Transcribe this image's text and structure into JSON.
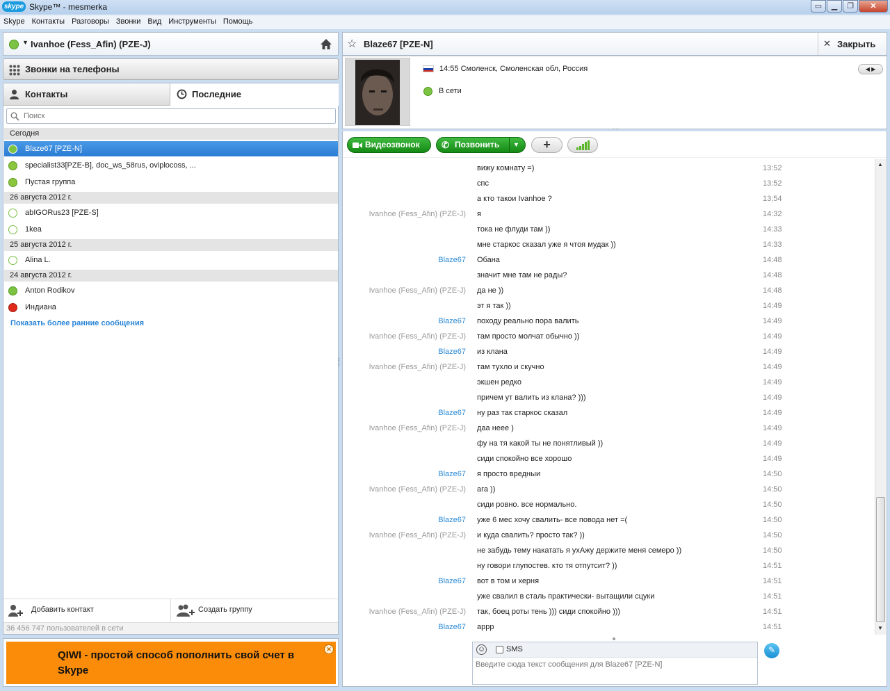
{
  "window": {
    "title": "Skype™ - mesmerka",
    "logo": "skype",
    "min": "▭",
    "restore": "▁",
    "max": "❐",
    "close": "✕"
  },
  "menu": [
    "Skype",
    "Контакты",
    "Разговоры",
    "Звонки",
    "Вид",
    "Инструменты",
    "Помощь"
  ],
  "profile": {
    "name": "Ivanhoe (Fess_Afin) (PZE-J)",
    "home_icon": "home-icon"
  },
  "phones": {
    "label": "Звонки на телефоны"
  },
  "tabs": {
    "contacts": "Контакты",
    "recent": "Последние"
  },
  "search": {
    "placeholder": "Поиск"
  },
  "recent": {
    "group_today": "Сегодня",
    "c1": "Blaze67 [PZE-N]",
    "c2": "specialist33[PZE-B], doc_ws_58rus, oviplocoss, ...",
    "c3": "Пустая группа",
    "group_aug26": "26 августа 2012 г.",
    "c4": "abIGORus23 [PZE-S]",
    "c5": "1kea",
    "group_aug25": "25 августа 2012 г.",
    "c6": "Alina L.",
    "group_aug24": "24 августа 2012 г.",
    "c7": "Anton Rodikov",
    "c8": "Индиана",
    "show_earlier": "Показать более ранние сообщения"
  },
  "bottom": {
    "add_contact": "Добавить контакт",
    "create_group": "Создать группу",
    "online_count": "36 456 747 пользователей в сети"
  },
  "ad": {
    "text": "QIWI - простой способ пополнить свой счет в Skype"
  },
  "chat": {
    "contact_name": "Blaze67 [PZE-N]",
    "close_label": "Закрыть",
    "location": "14:55 Смоленск, Смоленская обл, Россия",
    "status": "В сети",
    "video_btn": "Видеозвонок",
    "call_btn": "Позвонить",
    "plus_btn": "+",
    "input_placeholder": "Введите сюда текст сообщения для Blaze67 [PZE-N]",
    "sms_label": "SMS"
  },
  "messages": [
    {
      "author": "",
      "text": "вижу комнату =)",
      "time": "13:52",
      "who": ""
    },
    {
      "author": "",
      "text": "спс",
      "time": "13:52",
      "who": ""
    },
    {
      "author": "",
      "text": "а кто такои  Ivanhoe ?",
      "time": "13:54",
      "who": ""
    },
    {
      "author": "Ivanhoe (Fess_Afin) (PZE-J)",
      "text": "я",
      "time": "14:32",
      "who": "me"
    },
    {
      "author": "",
      "text": "тока не флуди там ))",
      "time": "14:33",
      "who": ""
    },
    {
      "author": "",
      "text": "мне старкос сказал уже я чтоя  мудак ))",
      "time": "14:33",
      "who": ""
    },
    {
      "author": "Blaze67",
      "text": "Обана",
      "time": "14:48",
      "who": "them"
    },
    {
      "author": "",
      "text": "значит мне там не рады?",
      "time": "14:48",
      "who": ""
    },
    {
      "author": "Ivanhoe (Fess_Afin) (PZE-J)",
      "text": "да не ))",
      "time": "14:48",
      "who": "me"
    },
    {
      "author": "",
      "text": "эт я так ))",
      "time": "14:49",
      "who": ""
    },
    {
      "author": "Blaze67",
      "text": "походу реально пора валить",
      "time": "14:49",
      "who": "them"
    },
    {
      "author": "Ivanhoe (Fess_Afin) (PZE-J)",
      "text": "там просто молчат обычно ))",
      "time": "14:49",
      "who": "me"
    },
    {
      "author": "Blaze67",
      "text": "из клана",
      "time": "14:49",
      "who": "them"
    },
    {
      "author": "Ivanhoe (Fess_Afin) (PZE-J)",
      "text": "там тухло и скучно",
      "time": "14:49",
      "who": "me"
    },
    {
      "author": "",
      "text": "экшен редко",
      "time": "14:49",
      "who": ""
    },
    {
      "author": "",
      "text": "причем ут валить из клана? )))",
      "time": "14:49",
      "who": ""
    },
    {
      "author": "Blaze67",
      "text": "ну раз так старкос сказал",
      "time": "14:49",
      "who": "them"
    },
    {
      "author": "Ivanhoe (Fess_Afin) (PZE-J)",
      "text": "даа неее )",
      "time": "14:49",
      "who": "me"
    },
    {
      "author": "",
      "text": "фу на тя какой ты не понятливый ))",
      "time": "14:49",
      "who": ""
    },
    {
      "author": "",
      "text": "сиди спокойно все хорошо",
      "time": "14:49",
      "who": ""
    },
    {
      "author": "Blaze67",
      "text": "я просто вредныи",
      "time": "14:50",
      "who": "them"
    },
    {
      "author": "Ivanhoe (Fess_Afin) (PZE-J)",
      "text": "ага ))",
      "time": "14:50",
      "who": "me"
    },
    {
      "author": "",
      "text": "сиди ровно. все нормально.",
      "time": "14:50",
      "who": ""
    },
    {
      "author": "Blaze67",
      "text": "уже 6 мес хочу свалить- все повода нет =(",
      "time": "14:50",
      "who": "them"
    },
    {
      "author": "Ivanhoe (Fess_Afin) (PZE-J)",
      "text": "и куда свалить? просто так? ))",
      "time": "14:50",
      "who": "me"
    },
    {
      "author": "",
      "text": "не забудь тему накатать я ухАжу держите меня семеро ))",
      "time": "14:50",
      "who": ""
    },
    {
      "author": "",
      "text": "ну говори глупостев. кто тя отпутсит? ))",
      "time": "14:51",
      "who": ""
    },
    {
      "author": "Blaze67",
      "text": "вот в том и херня",
      "time": "14:51",
      "who": "them"
    },
    {
      "author": "",
      "text": "уже свалил в сталь практически- вытащили сцуки",
      "time": "14:51",
      "who": ""
    },
    {
      "author": "Ivanhoe (Fess_Afin) (PZE-J)",
      "text": "так, боец роты тень ))) сиди спокойно )))",
      "time": "14:51",
      "who": "me"
    },
    {
      "author": "Blaze67",
      "text": "аррр",
      "time": "14:51",
      "who": "them"
    }
  ]
}
